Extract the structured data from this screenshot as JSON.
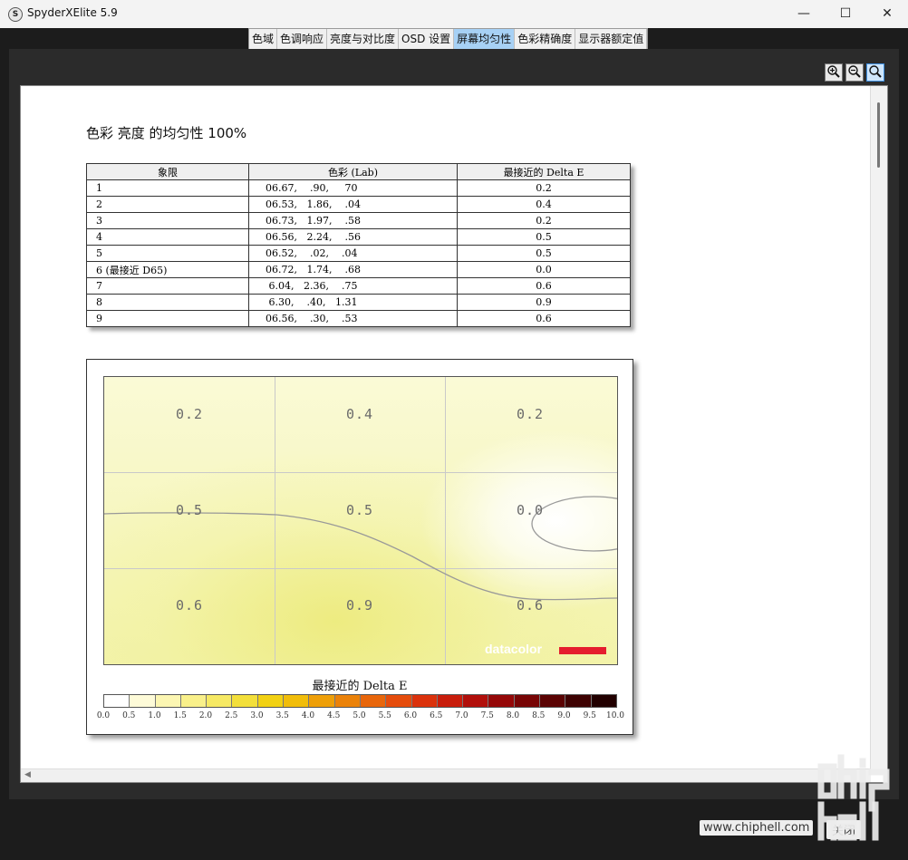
{
  "window": {
    "app_icon": "S",
    "title": "SpyderXElite 5.9",
    "minimize_glyph": "—",
    "maximize_glyph": "☐",
    "close_glyph": "✕"
  },
  "tabs": [
    {
      "label": "色域",
      "active": false
    },
    {
      "label": "色调响应",
      "active": false
    },
    {
      "label": "亮度与对比度",
      "active": false
    },
    {
      "label": "OSD 设置",
      "active": false
    },
    {
      "label": "屏幕均匀性",
      "active": true
    },
    {
      "label": "色彩精确度",
      "active": false
    },
    {
      "label": "显示器额定值",
      "active": false
    }
  ],
  "zoom": {
    "in_icon": "zoom-in-icon",
    "out_icon": "zoom-out-icon",
    "fit_icon": "zoom-fit-icon"
  },
  "report": {
    "title": "色彩 亮度 的均匀性 100%",
    "table": {
      "headers": [
        "象限",
        "色彩 (Lab)",
        "最接近的 Delta E"
      ],
      "rows": [
        {
          "quadrant": "1",
          "lab": "06.67,    .90,     70",
          "delta": "0.2"
        },
        {
          "quadrant": "2",
          "lab": "06.53,   1.86,    .04",
          "delta": "0.4"
        },
        {
          "quadrant": "3",
          "lab": "06.73,   1.97,    .58",
          "delta": "0.2"
        },
        {
          "quadrant": "4",
          "lab": "06.56,   2.24,    .56",
          "delta": "0.5"
        },
        {
          "quadrant": "5",
          "lab": "06.52,    .02,    .04",
          "delta": "0.5"
        },
        {
          "quadrant": "6 (最接近 D65)",
          "lab": "06.72,   1.74,    .68",
          "delta": "0.0"
        },
        {
          "quadrant": "7",
          "lab": " 6.04,   2.36,    .75",
          "delta": "0.6"
        },
        {
          "quadrant": "8",
          "lab": " 6.30,    .40,   1.31",
          "delta": "0.9"
        },
        {
          "quadrant": "9",
          "lab": "06.56,    .30,    .53",
          "delta": "0.6"
        }
      ]
    },
    "heatmap": {
      "cells": [
        "0.2",
        "0.4",
        "0.2",
        "0.5",
        "0.5",
        "0.0",
        "0.6",
        "0.9",
        "0.6"
      ],
      "logo_text": "datacolor",
      "colorbar_title": "最接近的 Delta E",
      "colorbar_ticks": [
        "0.0",
        "0.5",
        "1.0",
        "1.5",
        "2.0",
        "2.5",
        "3.0",
        "3.5",
        "4.0",
        "4.5",
        "5.0",
        "5.5",
        "6.0",
        "6.5",
        "7.0",
        "7.5",
        "8.0",
        "8.5",
        "9.0",
        "9.5",
        "10.0"
      ],
      "colorbar_colors": [
        "#ffffff",
        "#fefbd8",
        "#fcf6b2",
        "#f9f08a",
        "#f6e964",
        "#f3df3a",
        "#f2d113",
        "#f1bd0a",
        "#ee9f08",
        "#eb8209",
        "#e8660b",
        "#e54c0c",
        "#db320c",
        "#c81d0b",
        "#b10f0a",
        "#950808",
        "#780505",
        "#5b0303",
        "#3e0202",
        "#220000"
      ]
    }
  },
  "chart_data": {
    "type": "heatmap",
    "title": "色彩 亮度 的均匀性 100%",
    "rows": 3,
    "cols": 3,
    "values": [
      [
        0.2,
        0.4,
        0.2
      ],
      [
        0.5,
        0.5,
        0.0
      ],
      [
        0.6,
        0.9,
        0.6
      ]
    ],
    "colorbar_label": "最接近的 Delta E",
    "colorbar_range": [
      0.0,
      10.0
    ]
  },
  "footer": {
    "watermark": "www.chiphell.com",
    "close_label": "关闭",
    "overlay_logo": "chip hell"
  }
}
